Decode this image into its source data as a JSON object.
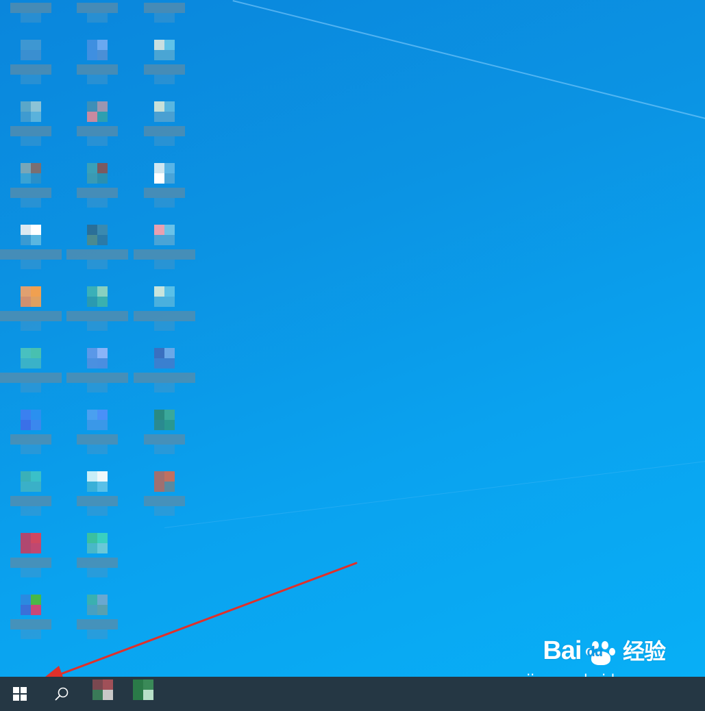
{
  "window": {
    "title": ""
  },
  "desktop": {
    "icons": [
      {
        "col": 0,
        "row": 0,
        "label": "",
        "colors": [
          "#4a7fa0",
          "#3f86b5",
          "#4a7fa0",
          "#3f86b5"
        ]
      },
      {
        "col": 1,
        "row": 0,
        "label": "",
        "colors": [
          "#5d7fa8",
          "#4a88c8",
          "#5d7fa8",
          "#4a88c8"
        ]
      },
      {
        "col": 2,
        "row": 0,
        "label": "",
        "colors": [
          "#5f8aa7",
          "#6b8ca6",
          "#5f8aa7",
          "#6b8ca6"
        ]
      },
      {
        "col": 0,
        "row": 1,
        "label": "",
        "colors": [
          "#3e97d2",
          "#3e97d2",
          "#3a8fd0",
          "#3a8fd0"
        ]
      },
      {
        "col": 1,
        "row": 1,
        "label": "",
        "colors": [
          "#3f8fe0",
          "#6aa8f0",
          "#3f8fe0",
          "#4a8fd6"
        ]
      },
      {
        "col": 2,
        "row": 1,
        "label": "",
        "colors": [
          "#c8dfe0",
          "#5fc2e8",
          "#4aa5d4",
          "#4aa5d4"
        ]
      },
      {
        "col": 0,
        "row": 2,
        "label": "",
        "colors": [
          "#5aa7c9",
          "#8cc3d6",
          "#3f9bd0",
          "#5ab2dc"
        ]
      },
      {
        "col": 1,
        "row": 2,
        "label": "",
        "colors": [
          "#3d8fb8",
          "#9c96b0",
          "#c78aa0",
          "#2e9fb0"
        ]
      },
      {
        "col": 2,
        "row": 2,
        "label": "",
        "colors": [
          "#c8e0d8",
          "#59b6e0",
          "#4aa0d2",
          "#4aa0d2"
        ]
      },
      {
        "col": 0,
        "row": 3,
        "label": "",
        "colors": [
          "#78a6b8",
          "#7a6f72",
          "#3aa2d4",
          "#2a8fc8"
        ]
      },
      {
        "col": 1,
        "row": 3,
        "label": "",
        "colors": [
          "#3aa0b8",
          "#7a5a60",
          "#3a9ab4",
          "#2a8fb0"
        ]
      },
      {
        "col": 2,
        "row": 3,
        "label": "",
        "colors": [
          "#d0e6f0",
          "#58b4e6",
          "#ffffff",
          "#4aa4d8"
        ]
      },
      {
        "col": 0,
        "row": 4,
        "label": "",
        "colors": [
          "#dce8f0",
          "#ffffff",
          "#3a9ad2",
          "#5ab6e0"
        ]
      },
      {
        "col": 1,
        "row": 4,
        "label": "",
        "colors": [
          "#2a6f98",
          "#3a8ab0",
          "#4a8a90",
          "#2a7aa8"
        ]
      },
      {
        "col": 2,
        "row": 4,
        "label": "",
        "colors": [
          "#e8a0b0",
          "#6ac2e8",
          "#4aa4d6",
          "#4aa4d6"
        ]
      },
      {
        "col": 0,
        "row": 5,
        "label": "",
        "colors": [
          "#e0a070",
          "#f0a050",
          "#d09070",
          "#e0a060"
        ]
      },
      {
        "col": 1,
        "row": 5,
        "label": "",
        "colors": [
          "#3ab0b8",
          "#88d0c0",
          "#2a9ab0",
          "#3ab0b0"
        ]
      },
      {
        "col": 2,
        "row": 5,
        "label": "",
        "colors": [
          "#c8e4dc",
          "#5ac0e8",
          "#4ab0de",
          "#4ab0de"
        ]
      },
      {
        "col": 0,
        "row": 6,
        "label": "",
        "colors": [
          "#48c0c0",
          "#48c0b0",
          "#3ab2c8",
          "#3ab2c8"
        ]
      },
      {
        "col": 1,
        "row": 6,
        "label": "",
        "colors": [
          "#5a98e8",
          "#8ab4f8",
          "#4a90e0",
          "#4a8ee0"
        ]
      },
      {
        "col": 2,
        "row": 6,
        "label": "",
        "colors": [
          "#3a70c0",
          "#6aa8e8",
          "#3a80d0",
          "#3a80d0"
        ]
      },
      {
        "col": 0,
        "row": 7,
        "label": "",
        "colors": [
          "#3a80f0",
          "#2a90f0",
          "#3a70e8",
          "#3a88ee"
        ]
      },
      {
        "col": 1,
        "row": 7,
        "label": "",
        "colors": [
          "#4aa0f0",
          "#4a90f8",
          "#3a98e8",
          "#3a98e8"
        ]
      },
      {
        "col": 2,
        "row": 7,
        "label": "",
        "colors": [
          "#2a8a80",
          "#3aa89a",
          "#2a8a90",
          "#2a9890"
        ]
      },
      {
        "col": 0,
        "row": 8,
        "label": "",
        "colors": [
          "#3ab0b8",
          "#3ac0c8",
          "#3ab0c8",
          "#3ab0c8"
        ]
      },
      {
        "col": 1,
        "row": 8,
        "label": "",
        "colors": [
          "#c8eef8",
          "#f0f8fa",
          "#3ab0d8",
          "#5ac0e8"
        ]
      },
      {
        "col": 2,
        "row": 8,
        "label": "",
        "colors": [
          "#a07070",
          "#c07060",
          "#a07070",
          "#5a8aa0"
        ]
      },
      {
        "col": 0,
        "row": 9,
        "label": "",
        "colors": [
          "#b04870",
          "#d04860",
          "#b04870",
          "#c04870"
        ]
      },
      {
        "col": 1,
        "row": 9,
        "label": "",
        "colors": [
          "#3ac0a0",
          "#3ad0c0",
          "#48b8c8",
          "#6ac8d8"
        ]
      },
      {
        "col": 0,
        "row": 10,
        "label": "",
        "colors": [
          "#2a8ae0",
          "#48b848",
          "#3a70d8",
          "#c84878"
        ]
      },
      {
        "col": 1,
        "row": 10,
        "label": "",
        "colors": [
          "#3ab0b0",
          "#6aa8d0",
          "#48a0c0",
          "#58a0b0"
        ]
      }
    ]
  },
  "watermark": {
    "brand_latin_1": "Bai",
    "brand_latin_2": "du",
    "brand_cn": "经验",
    "url": "jingyan.baidu.com"
  },
  "annotation": {
    "arrow_color": "#e0302a",
    "target": "start-button"
  },
  "taskbar": {
    "background": "#253744",
    "start_icon": "windows-logo-icon",
    "search_icon": "search-icon",
    "pinned_apps": [
      {
        "name": "pinned-app-1",
        "colors": [
          "#7a4850",
          "#a05058",
          "#3a7a58",
          "#c8c8c8"
        ]
      },
      {
        "name": "pinned-app-2",
        "colors": [
          "#2a7a48",
          "#3a8a58",
          "#2a7a48",
          "#b8e0c8"
        ]
      }
    ]
  }
}
